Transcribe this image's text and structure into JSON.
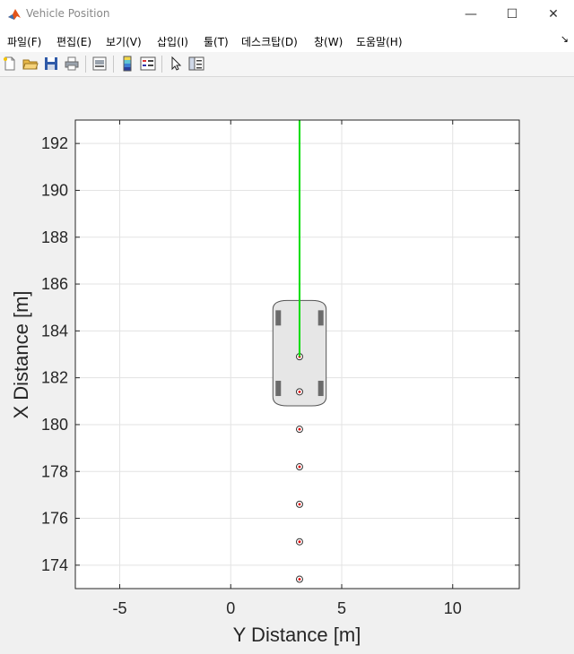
{
  "window": {
    "title": "Vehicle Position",
    "minimize_glyph": "—",
    "maximize_glyph": "☐",
    "close_glyph": "✕"
  },
  "menu": {
    "items": [
      "파일(F)",
      "편집(E)",
      "보기(V)",
      "삽입(I)",
      "툴(T)",
      "데스크탑(D)",
      "창(W)",
      "도움말(H)"
    ],
    "overflow_glyph": "↘"
  },
  "toolbar": {
    "icons": [
      "new-file-icon",
      "open-folder-icon",
      "save-icon",
      "print-icon",
      "print-preview-icon",
      "colorbar-icon",
      "legend-icon",
      "pointer-icon",
      "property-inspector-icon"
    ]
  },
  "chart_data": {
    "type": "scatter",
    "xlabel": "Y Distance [m]",
    "ylabel": "X Distance [m]",
    "xlim": [
      -7,
      13
    ],
    "ylim": [
      173,
      193
    ],
    "xticks": [
      -5,
      0,
      5,
      10
    ],
    "yticks": [
      174,
      176,
      178,
      180,
      182,
      184,
      186,
      188,
      190,
      192
    ],
    "grid": true,
    "path_color": "#00dd00",
    "marker_color": "#e00000",
    "trail_points": [
      {
        "y": 3.1,
        "x": 182.9
      },
      {
        "y": 3.1,
        "x": 181.4
      },
      {
        "y": 3.1,
        "x": 179.8
      },
      {
        "y": 3.1,
        "x": 178.2
      },
      {
        "y": 3.1,
        "x": 176.6
      },
      {
        "y": 3.1,
        "x": 175.0
      },
      {
        "y": 3.1,
        "x": 173.4
      }
    ],
    "path": [
      {
        "y": 3.1,
        "x": 182.9
      },
      {
        "y": 3.1,
        "x": 193
      }
    ],
    "vehicle": {
      "center_y": 3.1,
      "front_x": 185.3,
      "rear_x": 180.8,
      "width": 2.4
    }
  }
}
